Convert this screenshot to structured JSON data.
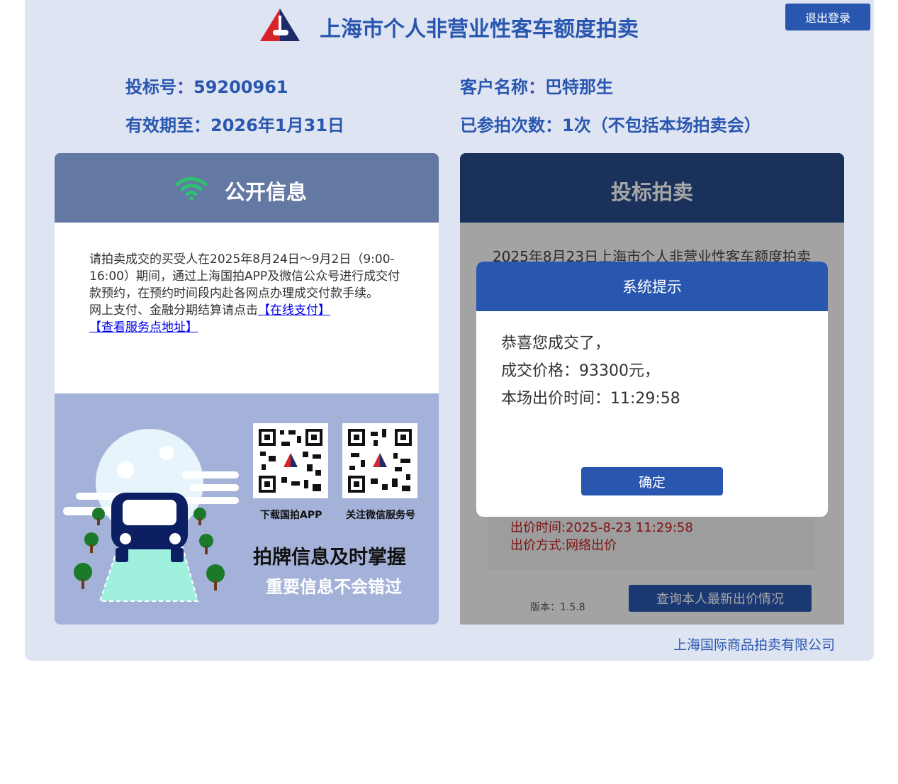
{
  "header": {
    "title": "上海市个人非营业性客车额度拍卖",
    "logout_label": "退出登录"
  },
  "bidder": {
    "bid_number": "投标号：59200961",
    "customer_name": "客户名称：巴特那生",
    "valid_until": "有效期至：2026年1月31日",
    "participation": "已参拍次数：1次（不包括本场拍卖会）"
  },
  "public_info": {
    "title": "公开信息",
    "paragraph": "请拍卖成交的买受人在2025年8月24日～9月2日（9:00-16:00）期间，通过上海国拍APP及微信公众号进行成交付款预约，在预约时间段内赴各网点办理成交付款手续。",
    "online_pay_prefix": "网上支付、金融分期结算请点击",
    "online_pay_link": "【在线支付】",
    "service_link": "【查看服务点地址】",
    "qr_app_label": "下载国拍APP",
    "qr_wechat_label": "关注微信服务号",
    "slogan_main": "拍牌信息及时掌握",
    "slogan_sub": "重要信息不会错过"
  },
  "bidding": {
    "title": "投标拍卖",
    "auction_name": "2025年8月23日上海市个人非营业性客车额度拍卖",
    "bid_time": "出价时间:2025-8-23 11:29:58",
    "bid_method": "出价方式:网络出价",
    "version": "版本：1.5.8",
    "query_button": "查询本人最新出价情况"
  },
  "modal": {
    "title": "系统提示",
    "line1": "恭喜您成交了，",
    "line2": "成交价格：93300元，",
    "line3": "本场出价时间：11:29:58",
    "ok_label": "确定"
  },
  "footer": {
    "company": "上海国际商品拍卖有限公司"
  },
  "colors": {
    "brand_blue": "#2957b0",
    "page_bg": "#dfe4f2",
    "wifi_green": "#2fbf71",
    "alert_red": "#c51b1b"
  }
}
